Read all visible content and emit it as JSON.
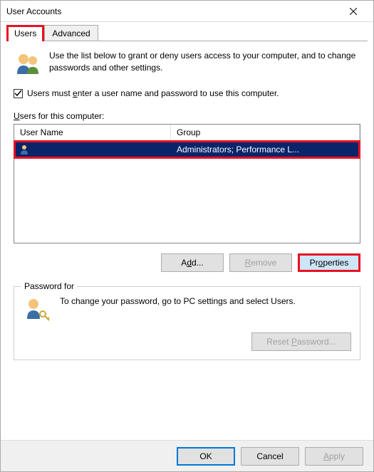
{
  "window": {
    "title": "User Accounts"
  },
  "tabs": {
    "users": "Users",
    "advanced": "Advanced"
  },
  "intro": "Use the list below to grant or deny users access to your computer, and to change passwords and other settings.",
  "checkbox_label_pre": "Users must ",
  "checkbox_label_u": "e",
  "checkbox_label_post": "nter a user name and password to use this computer.",
  "list_label_pre": "",
  "list_label_u": "U",
  "list_label_post": "sers for this computer:",
  "columns": {
    "username": "User Name",
    "group": "Group"
  },
  "rows": [
    {
      "username": "",
      "group": "Administrators; Performance L..."
    }
  ],
  "buttons": {
    "add": "Add...",
    "remove": "Remove",
    "properties": "Properties",
    "reset_pwd": "Reset Password...",
    "ok": "OK",
    "cancel": "Cancel",
    "apply": "Apply"
  },
  "fieldset_legend": "Password for",
  "pwd_text": "To change your password, go to PC settings and select Users."
}
